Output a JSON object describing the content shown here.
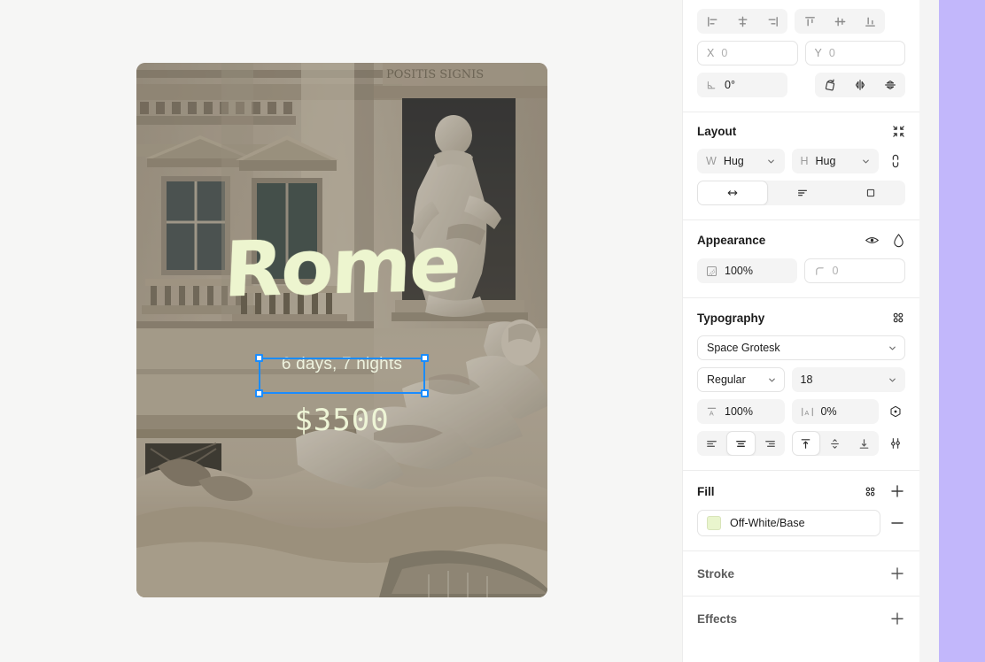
{
  "canvas": {
    "artboard": {
      "title": "Rome",
      "subtitle": "6 days, 7 nights",
      "price": "$3500",
      "image_alt": "trevi-fountain-rome"
    }
  },
  "inspector": {
    "transform": {
      "align_horizontal": [
        {
          "name": "align-left-icon",
          "label": "Align left"
        },
        {
          "name": "align-horizontal-center-icon",
          "label": "Align horizontal center"
        },
        {
          "name": "align-right-icon",
          "label": "Align right"
        }
      ],
      "align_vertical": [
        {
          "name": "align-top-icon",
          "label": "Align top"
        },
        {
          "name": "align-vertical-center-icon",
          "label": "Align vertical center"
        },
        {
          "name": "align-bottom-icon",
          "label": "Align bottom"
        }
      ],
      "x_label": "X",
      "x_value": "0",
      "y_label": "Y",
      "y_value": "0",
      "rotation_value": "0°",
      "rotate_label": "Rotate",
      "flip_h_label": "Flip horizontal",
      "flip_v_label": "Flip vertical"
    },
    "layout": {
      "title": "Layout",
      "collapse_label": "Collapse",
      "w_label": "W",
      "w_value": "Hug",
      "h_label": "H",
      "h_value": "Hug",
      "link_label": "Link dimensions",
      "modes": [
        {
          "name": "layout-mode-horizontal",
          "label": "Horizontal"
        },
        {
          "name": "layout-mode-stack",
          "label": "Stack"
        },
        {
          "name": "layout-mode-frame",
          "label": "Frame"
        }
      ]
    },
    "appearance": {
      "title": "Appearance",
      "visibility_label": "Toggle visibility",
      "blend_label": "Blend mode",
      "opacity_value": "100%",
      "corner_value": "0"
    },
    "typography": {
      "title": "Typography",
      "options_label": "Typography options",
      "font_family": "Space Grotesk",
      "font_weight": "Regular",
      "font_size": "18",
      "line_height": "100%",
      "letter_spacing": "0%",
      "variable_label": "Font variations",
      "advanced_label": "Advanced type settings",
      "h_align": [
        {
          "name": "text-align-left-icon",
          "label": "Align text left"
        },
        {
          "name": "text-align-center-icon",
          "label": "Align text center"
        },
        {
          "name": "text-align-right-icon",
          "label": "Align text right"
        }
      ],
      "v_align": [
        {
          "name": "text-align-top-icon",
          "label": "Align text top"
        },
        {
          "name": "text-align-middle-icon",
          "label": "Align text middle"
        },
        {
          "name": "text-align-bottom-icon",
          "label": "Align text bottom"
        }
      ]
    },
    "fill": {
      "title": "Fill",
      "options_label": "Fill options",
      "add_label": "Add fill",
      "item_name": "Off-White/Base",
      "swatch_color": "#e9f5cd",
      "remove_label": "Remove fill"
    },
    "stroke": {
      "title": "Stroke",
      "add_label": "Add stroke"
    },
    "effects": {
      "title": "Effects",
      "add_label": "Add effect"
    }
  },
  "theme": {
    "accent": "#1a8cff",
    "strip": "#c2b7fb",
    "canvas_bg": "#f6f6f5"
  }
}
